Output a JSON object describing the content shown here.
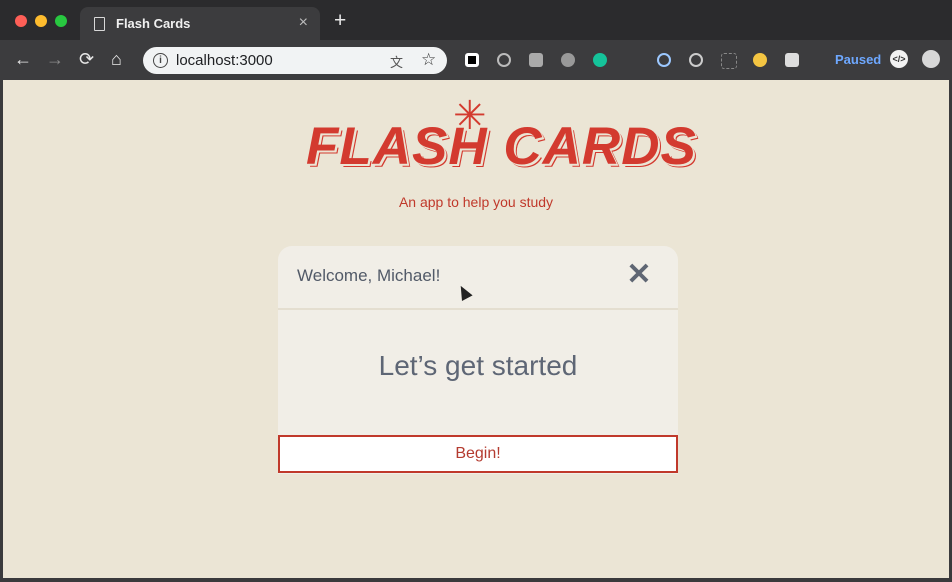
{
  "browser": {
    "tab_title": "Flash Cards",
    "tab_close": "×",
    "new_tab": "+",
    "url": "localhost:3000",
    "status": "Paused",
    "buttons": {
      "back": "←",
      "forward": "→",
      "reload": "⟳",
      "home": "⌂",
      "star": "☆"
    }
  },
  "app": {
    "logo_text": "FLASH CARDS",
    "subtitle": "An app to help you study",
    "colors": {
      "accent": "#d33a2f",
      "background": "#ebe5d5",
      "card": "#f1eee7"
    }
  },
  "card": {
    "greeting": "Welcome, Michael!",
    "close_symbol": "✕",
    "message": "Let’s get started",
    "begin_button": "Begin!"
  }
}
